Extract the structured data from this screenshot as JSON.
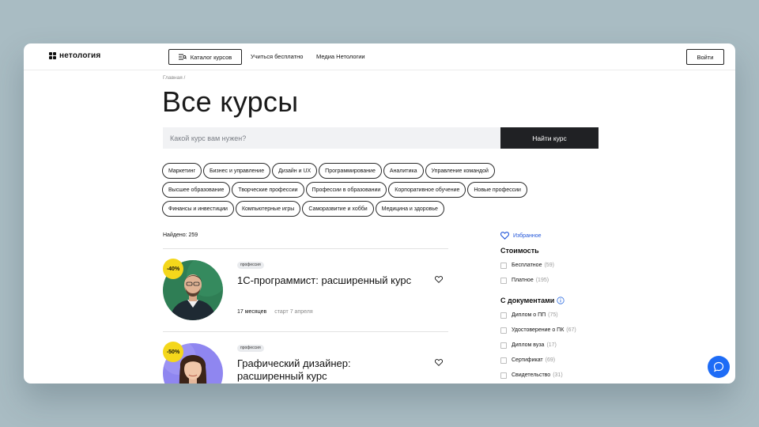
{
  "header": {
    "logo_text": "нетология",
    "catalog_label": "Каталог курсов",
    "nav": [
      "Учиться бесплатно",
      "Медиа Нетологии"
    ],
    "login_label": "Войти"
  },
  "breadcrumb": "Главная /",
  "title": "Все курсы",
  "search": {
    "placeholder": "Какой курс вам нужен?",
    "button_label": "Найти курс"
  },
  "categories": [
    [
      "Маркетинг",
      "Бизнес и управление",
      "Дизайн и UX",
      "Программирование",
      "Аналитика",
      "Управление командой"
    ],
    [
      "Высшее образование",
      "Творческие профессии",
      "Профессии в образовании",
      "Корпоративное обучение",
      "Новые профессии"
    ],
    [
      "Финансы и инвестиции",
      "Компьютерные игры",
      "Саморазвитие и хобби",
      "Медицина и здоровье"
    ]
  ],
  "found_label": "Найдено: 259",
  "courses": [
    {
      "discount": "-40%",
      "tag": "профессия",
      "title": "1С-программист: расширенный курс",
      "duration": "17 месяцев",
      "start": "старт 7 апреля"
    },
    {
      "discount": "-50%",
      "tag": "профессия",
      "title": "Графический дизайнер: расширенный курс",
      "duration": "",
      "start": ""
    }
  ],
  "sidebar": {
    "favorites_label": "Избранное",
    "cost": {
      "heading": "Стоимость",
      "options": [
        {
          "label": "Бесплатное",
          "count": "(59)"
        },
        {
          "label": "Платное",
          "count": "(195)"
        }
      ]
    },
    "docs": {
      "heading": "С документами",
      "options": [
        {
          "label": "Диплом о ПП",
          "count": "(75)"
        },
        {
          "label": "Удостоверение о ПК",
          "count": "(67)"
        },
        {
          "label": "Диплом вуза",
          "count": "(17)"
        },
        {
          "label": "Сертификат",
          "count": "(69)"
        },
        {
          "label": "Свидетельство",
          "count": "(31)"
        }
      ]
    }
  },
  "colors": {
    "background": "#a9bcc3",
    "accent_blue": "#1e6cf6",
    "discount_yellow": "#f4d71b",
    "button_dark": "#202124"
  },
  "icons": [
    "catalog-icon",
    "heart-icon",
    "info-icon",
    "chat-icon"
  ]
}
